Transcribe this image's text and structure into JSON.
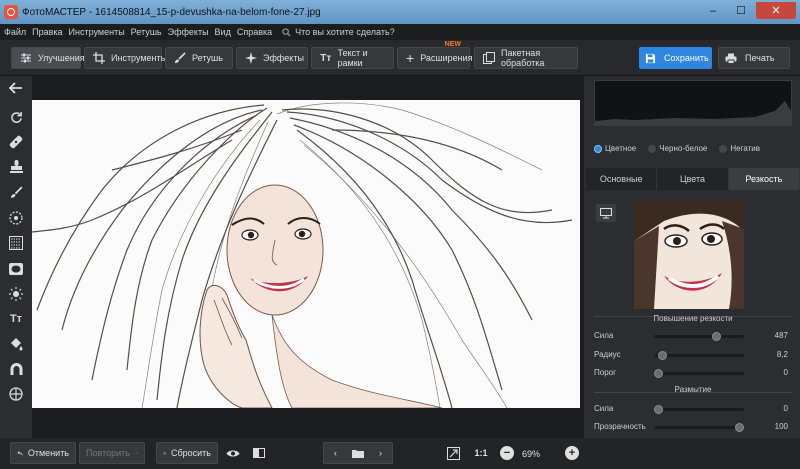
{
  "window": {
    "title": "ФотоМАСТЕР - 1614508814_15-p-devushka-na-belom-fone-27.jpg",
    "minimize": "–",
    "maximize": "☐",
    "close": "✕"
  },
  "menu": {
    "items": [
      "Файл",
      "Правка",
      "Инструменты",
      "Ретушь",
      "Эффекты",
      "Вид",
      "Справка"
    ],
    "search_placeholder": "Что вы хотите сделать?"
  },
  "toolbar": {
    "tabs": [
      {
        "label": "Улучшения",
        "icon": "sliders-icon",
        "active": true
      },
      {
        "label": "Инструменты",
        "icon": "crop-icon",
        "active": false
      },
      {
        "label": "Ретушь",
        "icon": "brush-icon",
        "active": false
      },
      {
        "label": "Эффекты",
        "icon": "sparkle-icon",
        "active": false
      },
      {
        "label": "Текст и рамки",
        "icon": "text-icon",
        "active": false
      },
      {
        "label": "Расширения",
        "icon": "plus-icon",
        "active": false,
        "badge": "NEW"
      },
      {
        "label": "Пакетная обработка",
        "icon": "batch-icon",
        "active": false
      }
    ],
    "save_label": "Сохранить",
    "print_label": "Печать",
    "accent_color": "#2f86e0"
  },
  "left_tools": [
    "back-arrow-icon",
    "rotate-icon",
    "bandage-icon",
    "stamp-icon",
    "brush-icon",
    "radial-icon",
    "gradient-icon",
    "vignette-icon",
    "light-icon",
    "text-tool-icon",
    "fill-icon",
    "magnet-icon",
    "globe-icon"
  ],
  "color_mode": {
    "options": [
      "Цветное",
      "Черно-белое",
      "Негатив"
    ],
    "selected": "Цветное"
  },
  "panel_tabs": [
    {
      "label": "Основные",
      "active": false
    },
    {
      "label": "Цвета",
      "active": false
    },
    {
      "label": "Резкость",
      "active": true
    }
  ],
  "sharpening": {
    "title": "Повышение резкости",
    "sliders": [
      {
        "label": "Сила",
        "value": "487",
        "fraction": 0.72
      },
      {
        "label": "Радиус",
        "value": "8,2",
        "fraction": 0.05
      },
      {
        "label": "Порог",
        "value": "0",
        "fraction": 0.0
      }
    ]
  },
  "blur": {
    "title": "Размытие",
    "sliders": [
      {
        "label": "Сила",
        "value": "0",
        "fraction": 0.0
      },
      {
        "label": "Прозрачность",
        "value": "100",
        "fraction": 1.0
      }
    ]
  },
  "bottom": {
    "undo_label": "Отменить",
    "redo_label": "Повторить",
    "reset_label": "Сбросить",
    "ratio_label": "1:1",
    "zoom_value": "69%"
  }
}
